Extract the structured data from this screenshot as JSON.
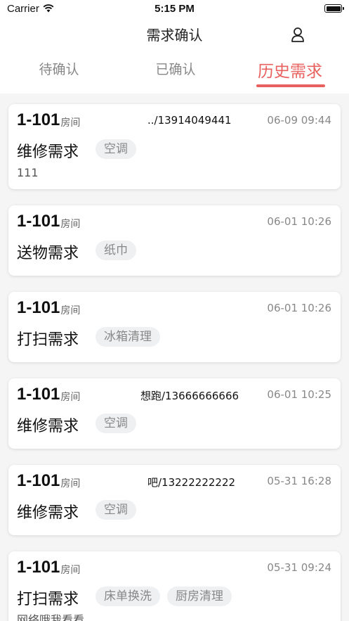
{
  "status_bar": {
    "carrier": "Carrier",
    "time": "5:15 PM"
  },
  "nav": {
    "title": "需求确认"
  },
  "tabs": [
    {
      "label": "待确认",
      "active": false
    },
    {
      "label": "已确认",
      "active": false
    },
    {
      "label": "历史需求",
      "active": true
    }
  ],
  "colors": {
    "accent": "#e8615f",
    "tag_bg": "#eef0f2"
  },
  "requests": [
    {
      "room": "1-101",
      "unit": "房间",
      "contact": "../13914049441",
      "time": "06-09 09:44",
      "type": "维修需求",
      "tags": [
        "空调"
      ],
      "note": "111"
    },
    {
      "room": "1-101",
      "unit": "房间",
      "contact": "",
      "time": "06-01 10:26",
      "type": "送物需求",
      "tags": [
        "纸巾"
      ],
      "note": ""
    },
    {
      "room": "1-101",
      "unit": "房间",
      "contact": "",
      "time": "06-01 10:26",
      "type": "打扫需求",
      "tags": [
        "冰箱清理"
      ],
      "note": ""
    },
    {
      "room": "1-101",
      "unit": "房间",
      "contact": "想跑/13666666666",
      "time": "06-01 10:25",
      "type": "维修需求",
      "tags": [
        "空调"
      ],
      "note": ""
    },
    {
      "room": "1-101",
      "unit": "房间",
      "contact": "吧/13222222222",
      "time": "05-31 16:28",
      "type": "维修需求",
      "tags": [
        "空调"
      ],
      "note": ""
    },
    {
      "room": "1-101",
      "unit": "房间",
      "contact": "",
      "time": "05-31 09:24",
      "type": "打扫需求",
      "tags": [
        "床单换洗",
        "厨房清理"
      ],
      "note": "网络哦我看看"
    }
  ]
}
